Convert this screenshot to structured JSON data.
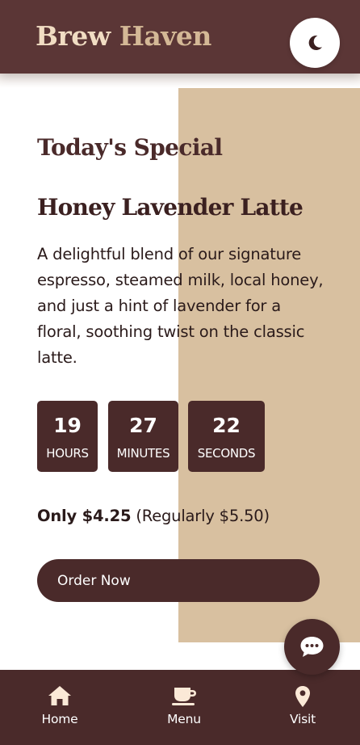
{
  "header": {
    "brand_word1": "Brew",
    "brand_word2": "Haven",
    "theme_toggle_icon": "moon-icon"
  },
  "special": {
    "section_title": "Today's Special",
    "product_name": "Honey Lavender Latte",
    "description": "A delightful blend of our signature espresso, steamed milk, local honey, and just a hint of lavender for a floral, soothing twist on the classic latte.",
    "countdown": [
      {
        "value": "19",
        "label": "HOURS"
      },
      {
        "value": "27",
        "label": "MINUTES"
      },
      {
        "value": "22",
        "label": "SECONDS"
      }
    ],
    "price_prefix": "Only $4.25",
    "price_regular": "(Regularly $5.50)",
    "order_button": "Order Now"
  },
  "chat_fab_icon": "chat-bubble-icon",
  "bottom_nav": [
    {
      "label": "Home",
      "icon": "home-icon"
    },
    {
      "label": "Menu",
      "icon": "coffee-cup-icon"
    },
    {
      "label": "Visit",
      "icon": "location-pin-icon"
    }
  ],
  "colors": {
    "header_bg": "#5b3636",
    "dark_brown": "#4a2a2a",
    "tan": "#d8c0a0",
    "brand_light": "#f1ddc3",
    "brand_accent": "#d4b896"
  }
}
